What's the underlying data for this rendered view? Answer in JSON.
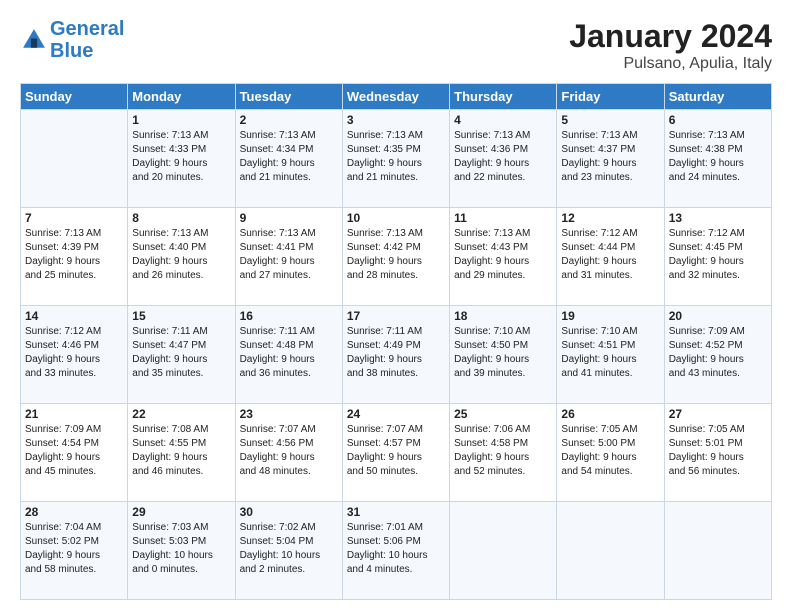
{
  "logo": {
    "line1": "General",
    "line2": "Blue"
  },
  "title": "January 2024",
  "subtitle": "Pulsano, Apulia, Italy",
  "header_days": [
    "Sunday",
    "Monday",
    "Tuesday",
    "Wednesday",
    "Thursday",
    "Friday",
    "Saturday"
  ],
  "weeks": [
    [
      {
        "day": "",
        "info": ""
      },
      {
        "day": "1",
        "info": "Sunrise: 7:13 AM\nSunset: 4:33 PM\nDaylight: 9 hours\nand 20 minutes."
      },
      {
        "day": "2",
        "info": "Sunrise: 7:13 AM\nSunset: 4:34 PM\nDaylight: 9 hours\nand 21 minutes."
      },
      {
        "day": "3",
        "info": "Sunrise: 7:13 AM\nSunset: 4:35 PM\nDaylight: 9 hours\nand 21 minutes."
      },
      {
        "day": "4",
        "info": "Sunrise: 7:13 AM\nSunset: 4:36 PM\nDaylight: 9 hours\nand 22 minutes."
      },
      {
        "day": "5",
        "info": "Sunrise: 7:13 AM\nSunset: 4:37 PM\nDaylight: 9 hours\nand 23 minutes."
      },
      {
        "day": "6",
        "info": "Sunrise: 7:13 AM\nSunset: 4:38 PM\nDaylight: 9 hours\nand 24 minutes."
      }
    ],
    [
      {
        "day": "7",
        "info": "Sunrise: 7:13 AM\nSunset: 4:39 PM\nDaylight: 9 hours\nand 25 minutes."
      },
      {
        "day": "8",
        "info": "Sunrise: 7:13 AM\nSunset: 4:40 PM\nDaylight: 9 hours\nand 26 minutes."
      },
      {
        "day": "9",
        "info": "Sunrise: 7:13 AM\nSunset: 4:41 PM\nDaylight: 9 hours\nand 27 minutes."
      },
      {
        "day": "10",
        "info": "Sunrise: 7:13 AM\nSunset: 4:42 PM\nDaylight: 9 hours\nand 28 minutes."
      },
      {
        "day": "11",
        "info": "Sunrise: 7:13 AM\nSunset: 4:43 PM\nDaylight: 9 hours\nand 29 minutes."
      },
      {
        "day": "12",
        "info": "Sunrise: 7:12 AM\nSunset: 4:44 PM\nDaylight: 9 hours\nand 31 minutes."
      },
      {
        "day": "13",
        "info": "Sunrise: 7:12 AM\nSunset: 4:45 PM\nDaylight: 9 hours\nand 32 minutes."
      }
    ],
    [
      {
        "day": "14",
        "info": "Sunrise: 7:12 AM\nSunset: 4:46 PM\nDaylight: 9 hours\nand 33 minutes."
      },
      {
        "day": "15",
        "info": "Sunrise: 7:11 AM\nSunset: 4:47 PM\nDaylight: 9 hours\nand 35 minutes."
      },
      {
        "day": "16",
        "info": "Sunrise: 7:11 AM\nSunset: 4:48 PM\nDaylight: 9 hours\nand 36 minutes."
      },
      {
        "day": "17",
        "info": "Sunrise: 7:11 AM\nSunset: 4:49 PM\nDaylight: 9 hours\nand 38 minutes."
      },
      {
        "day": "18",
        "info": "Sunrise: 7:10 AM\nSunset: 4:50 PM\nDaylight: 9 hours\nand 39 minutes."
      },
      {
        "day": "19",
        "info": "Sunrise: 7:10 AM\nSunset: 4:51 PM\nDaylight: 9 hours\nand 41 minutes."
      },
      {
        "day": "20",
        "info": "Sunrise: 7:09 AM\nSunset: 4:52 PM\nDaylight: 9 hours\nand 43 minutes."
      }
    ],
    [
      {
        "day": "21",
        "info": "Sunrise: 7:09 AM\nSunset: 4:54 PM\nDaylight: 9 hours\nand 45 minutes."
      },
      {
        "day": "22",
        "info": "Sunrise: 7:08 AM\nSunset: 4:55 PM\nDaylight: 9 hours\nand 46 minutes."
      },
      {
        "day": "23",
        "info": "Sunrise: 7:07 AM\nSunset: 4:56 PM\nDaylight: 9 hours\nand 48 minutes."
      },
      {
        "day": "24",
        "info": "Sunrise: 7:07 AM\nSunset: 4:57 PM\nDaylight: 9 hours\nand 50 minutes."
      },
      {
        "day": "25",
        "info": "Sunrise: 7:06 AM\nSunset: 4:58 PM\nDaylight: 9 hours\nand 52 minutes."
      },
      {
        "day": "26",
        "info": "Sunrise: 7:05 AM\nSunset: 5:00 PM\nDaylight: 9 hours\nand 54 minutes."
      },
      {
        "day": "27",
        "info": "Sunrise: 7:05 AM\nSunset: 5:01 PM\nDaylight: 9 hours\nand 56 minutes."
      }
    ],
    [
      {
        "day": "28",
        "info": "Sunrise: 7:04 AM\nSunset: 5:02 PM\nDaylight: 9 hours\nand 58 minutes."
      },
      {
        "day": "29",
        "info": "Sunrise: 7:03 AM\nSunset: 5:03 PM\nDaylight: 10 hours\nand 0 minutes."
      },
      {
        "day": "30",
        "info": "Sunrise: 7:02 AM\nSunset: 5:04 PM\nDaylight: 10 hours\nand 2 minutes."
      },
      {
        "day": "31",
        "info": "Sunrise: 7:01 AM\nSunset: 5:06 PM\nDaylight: 10 hours\nand 4 minutes."
      },
      {
        "day": "",
        "info": ""
      },
      {
        "day": "",
        "info": ""
      },
      {
        "day": "",
        "info": ""
      }
    ]
  ]
}
